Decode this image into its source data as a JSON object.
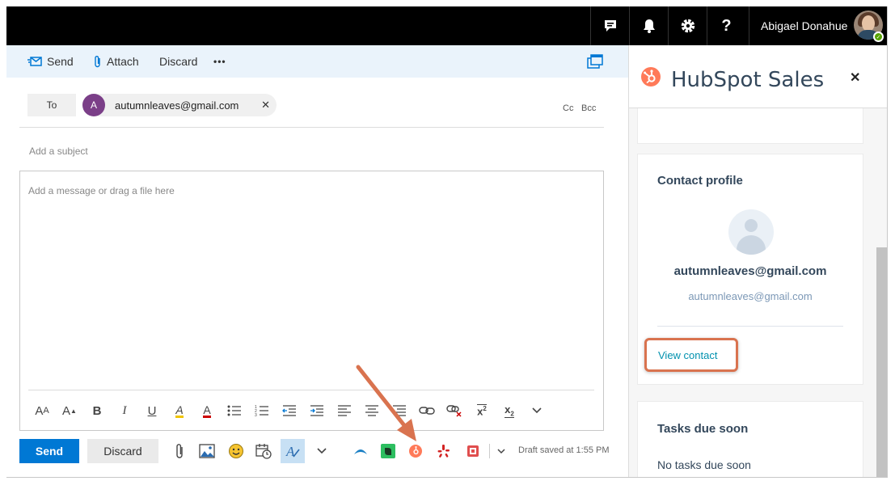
{
  "topbar": {
    "user_name": "Abigael Donahue",
    "icons": [
      "feedback-icon",
      "bell-icon",
      "gear-icon",
      "help-icon"
    ],
    "help_label": "?"
  },
  "command_bar": {
    "send": "Send",
    "attach": "Attach",
    "discard": "Discard",
    "more": "•••"
  },
  "recipients": {
    "to_label": "To",
    "chip_initial": "A",
    "chip_email": "autumnleaves@gmail.com",
    "remove": "✕",
    "cc": "Cc",
    "bcc": "Bcc"
  },
  "subject": {
    "placeholder": "Add a subject"
  },
  "message": {
    "placeholder": "Add a message or drag a file here"
  },
  "format_toolbar": [
    {
      "name": "font-size-icon",
      "glyph": "AA"
    },
    {
      "name": "grow-font-icon",
      "glyph": "A"
    },
    {
      "name": "bold-icon",
      "glyph": "B"
    },
    {
      "name": "italic-icon",
      "glyph": "I"
    },
    {
      "name": "underline-icon",
      "glyph": "U"
    },
    {
      "name": "highlight-icon",
      "glyph": "A"
    },
    {
      "name": "font-color-icon",
      "glyph": "A"
    },
    {
      "name": "bullets-icon",
      "glyph": "☰"
    },
    {
      "name": "numbering-icon",
      "glyph": "☰"
    },
    {
      "name": "decrease-indent-icon",
      "glyph": "⇤"
    },
    {
      "name": "increase-indent-icon",
      "glyph": "⇥"
    },
    {
      "name": "align-left-icon",
      "glyph": "≡"
    },
    {
      "name": "align-center-icon",
      "glyph": "≡"
    },
    {
      "name": "align-right-icon",
      "glyph": "≡"
    },
    {
      "name": "insert-link-icon",
      "glyph": "∞"
    },
    {
      "name": "remove-link-icon",
      "glyph": "∞"
    },
    {
      "name": "superscript-icon",
      "glyph": "x²"
    },
    {
      "name": "subscript-icon",
      "glyph": "x₂"
    },
    {
      "name": "more-format-icon",
      "glyph": "⌄"
    }
  ],
  "bottom_bar": {
    "send": "Send",
    "discard": "Discard",
    "draft_status": "Draft saved at 1:55 PM"
  },
  "panel": {
    "title": "HubSpot Sales",
    "close": "✕",
    "contact_card_title": "Contact profile",
    "contact_name": "autumnleaves@gmail.com",
    "contact_email": "autumnleaves@gmail.com",
    "view_contact": "View contact",
    "tasks_title": "Tasks due soon",
    "tasks_empty": "No tasks due soon"
  },
  "colors": {
    "accent_blue": "#0078d4",
    "hubspot_orange": "#ff7a59",
    "annotation_orange": "#d9734f",
    "link_teal": "#0091ae"
  }
}
